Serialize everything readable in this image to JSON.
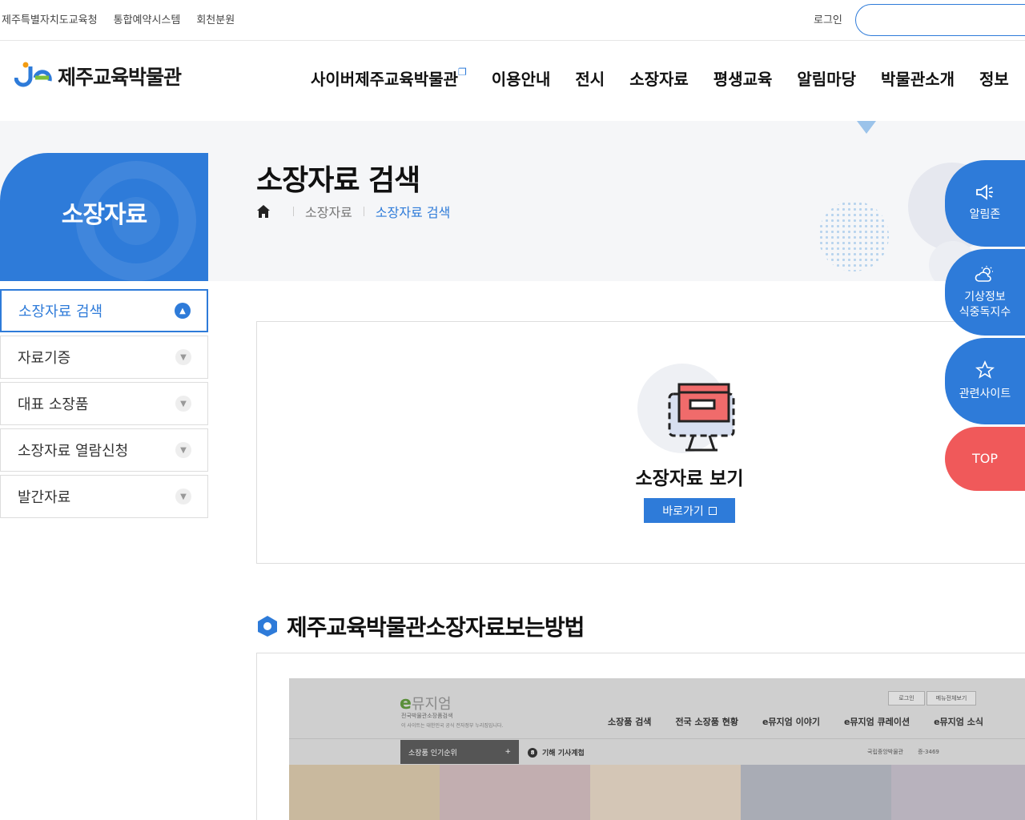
{
  "topbar": {
    "links": [
      "제주특별자치도교육청",
      "통합예약시스템",
      "회천분원"
    ],
    "login": "로그인",
    "search_placeholder": ""
  },
  "header": {
    "logo_text": "제주교육박물관",
    "nav": [
      "사이버제주교육박물관",
      "이용안내",
      "전시",
      "소장자료",
      "평생교육",
      "알림마당",
      "박물관소개",
      "정보"
    ]
  },
  "sidebar": {
    "title": "소장자료",
    "items": [
      {
        "label": "소장자료 검색",
        "active": true
      },
      {
        "label": "자료기증",
        "active": false
      },
      {
        "label": "대표 소장품",
        "active": false
      },
      {
        "label": "소장자료 열람신청",
        "active": false
      },
      {
        "label": "발간자료",
        "active": false
      }
    ]
  },
  "page": {
    "title": "소장자료 검색",
    "breadcrumb": [
      "소장자료",
      "소장자료 검색"
    ]
  },
  "collection_box": {
    "label": "소장자료 보기",
    "button": "바로가기"
  },
  "section": {
    "heading": "제주교육박물관소장자료보는방법"
  },
  "screenshot": {
    "logo_e": "e",
    "logo_rest": "뮤지엄",
    "sub": "전국박물관소장품검색",
    "sub2": "이 사이트는 대한민국 공식 전자정부 누리집입니다.",
    "top_buttons": [
      "로그인",
      "메뉴전체보기"
    ],
    "nav": [
      "소장품 검색",
      "전국 소장품 현황",
      "e뮤지엄 이야기",
      "e뮤지엄 큐레이션",
      "e뮤지엄 소식"
    ],
    "popular": "소장품 인기순위",
    "popular_plus": "+",
    "notice_num": "8",
    "notice": "기해 기사계첩",
    "meta": [
      "국립중앙박물관",
      "증-3469"
    ]
  },
  "quick_menu": [
    {
      "label": "알림존",
      "icon": "megaphone-icon"
    },
    {
      "label": "기상정보\n식중독지수",
      "icon": "weather-icon"
    },
    {
      "label": "관련사이트",
      "icon": "star-icon"
    },
    {
      "label": "TOP",
      "icon": ""
    }
  ],
  "colors": {
    "primary": "#2e7bd9",
    "top_button": "#f0595a"
  }
}
